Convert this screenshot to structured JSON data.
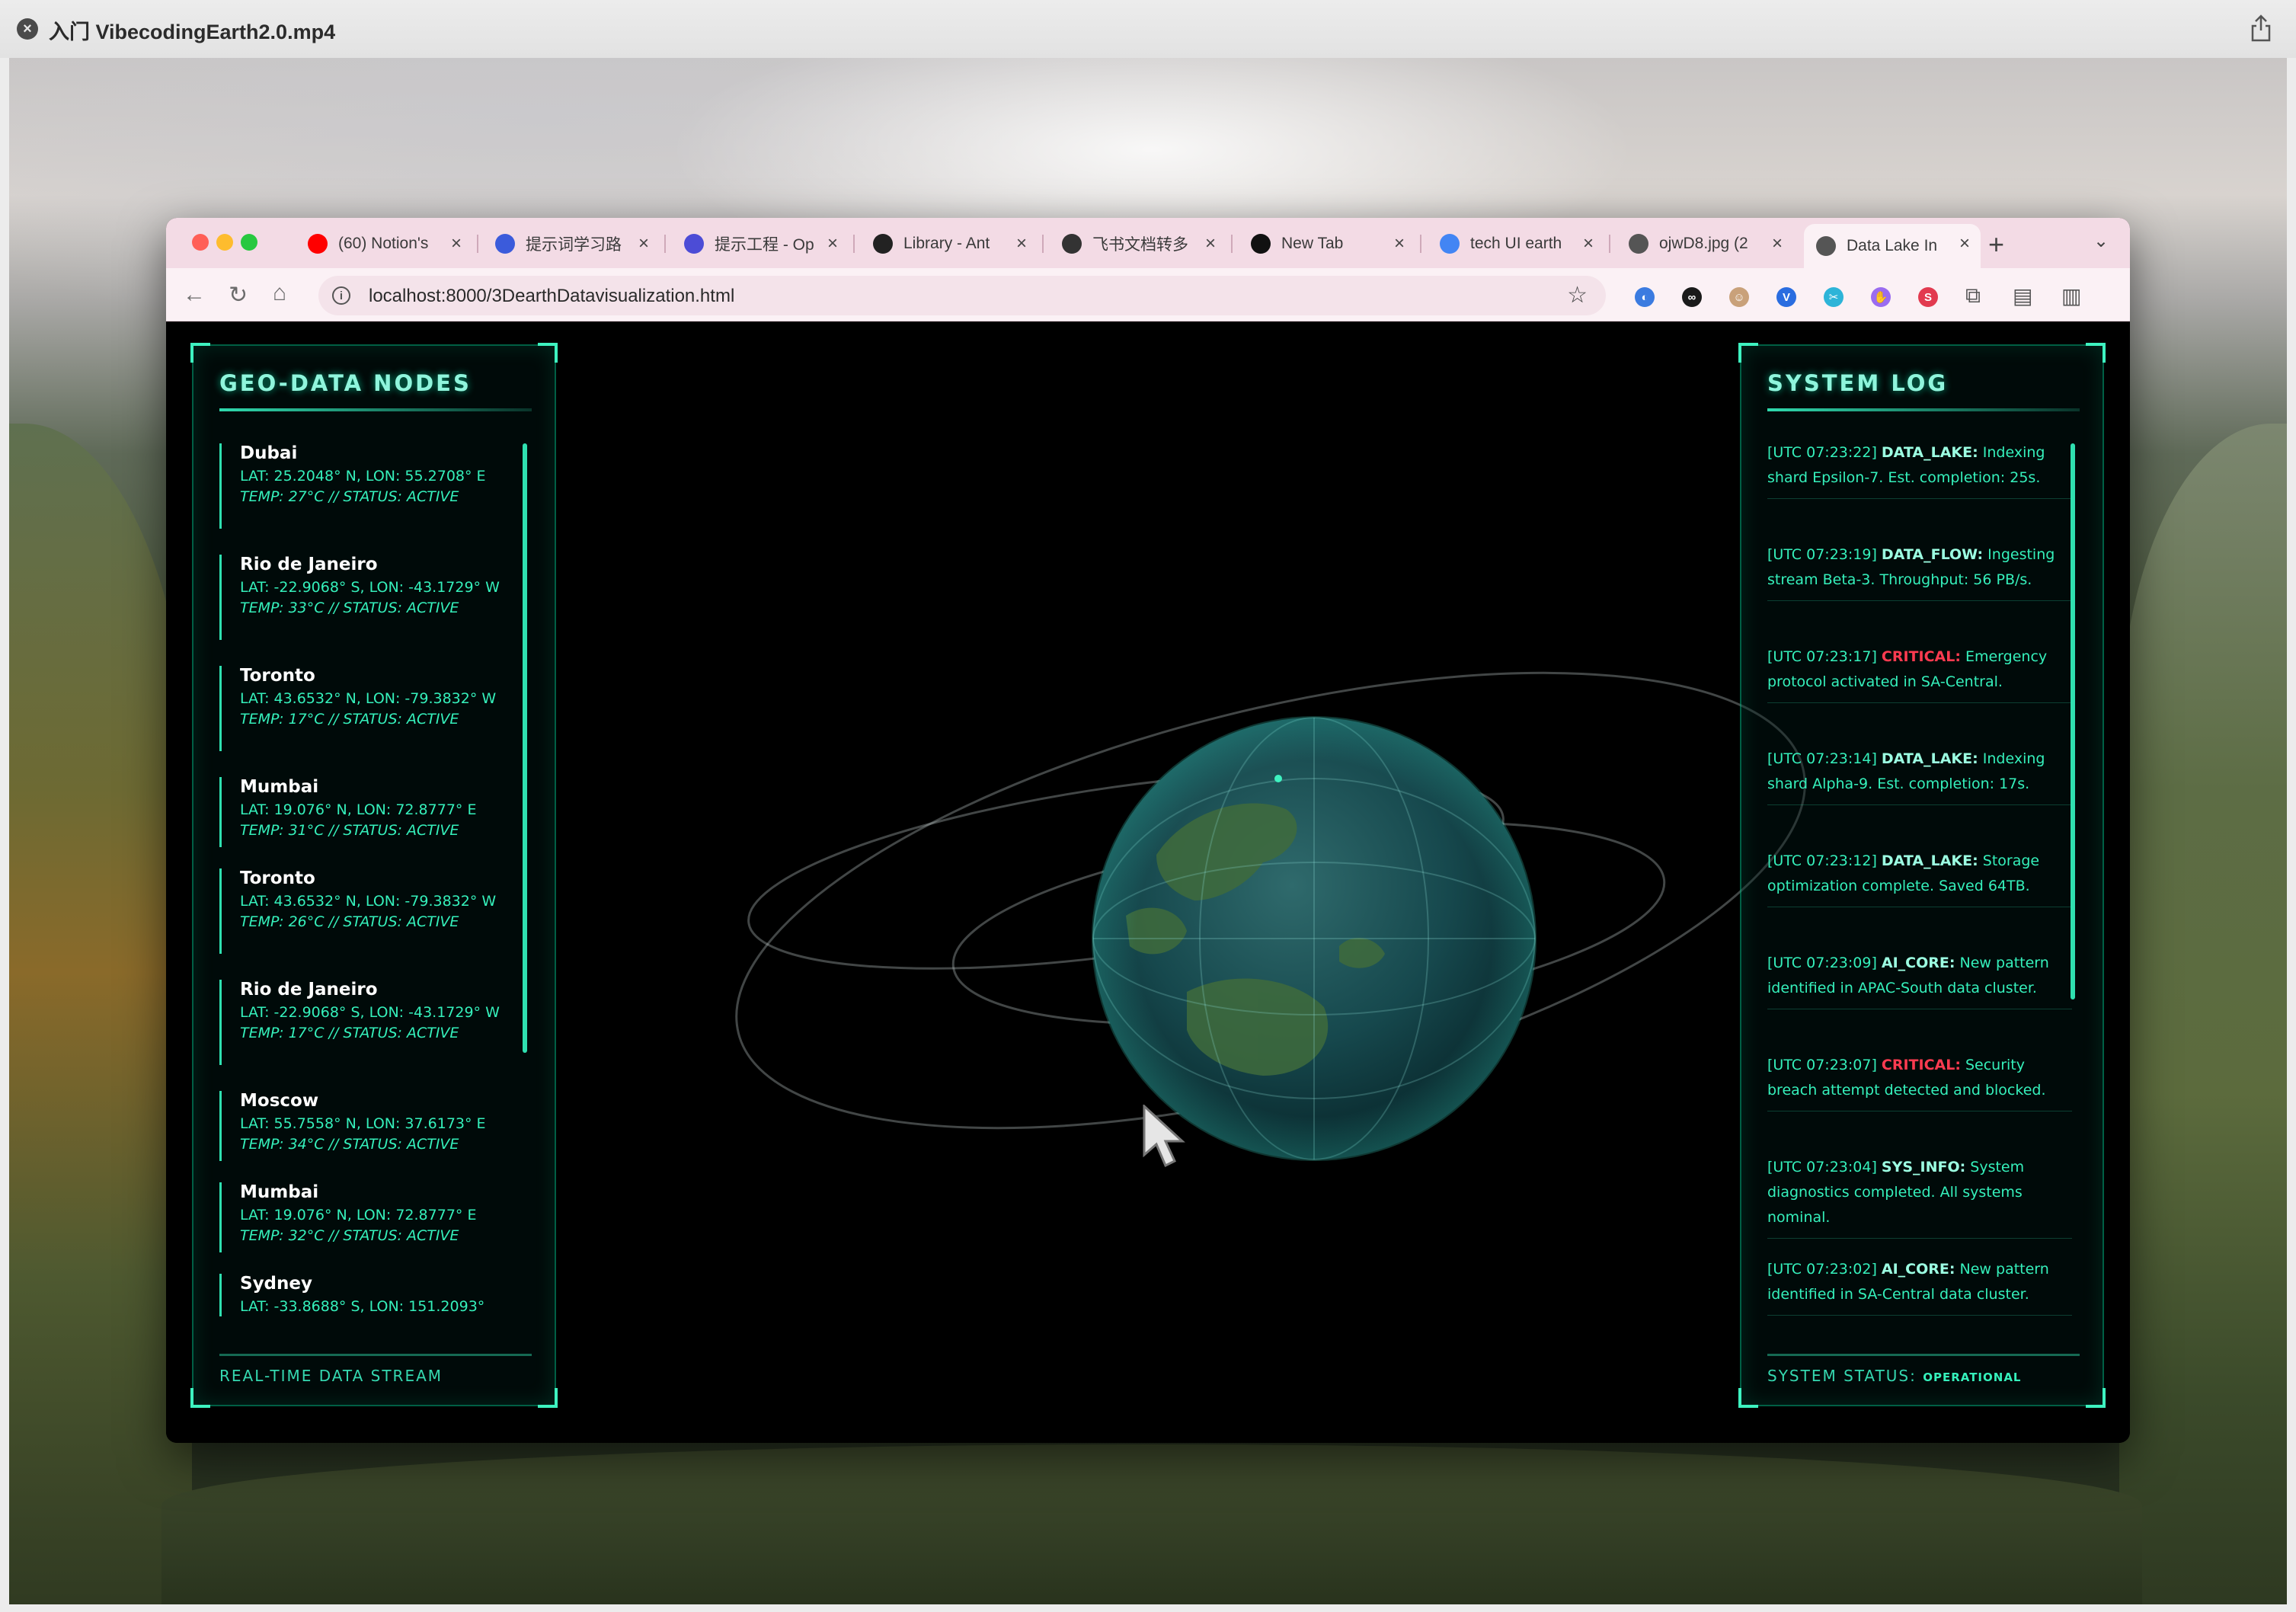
{
  "viewer": {
    "title": "入门 VibecodingEarth2.0.mp4"
  },
  "browser": {
    "tabs": [
      {
        "label": "(60) Notion's",
        "icon": "youtube-icon",
        "color": "#ff0000"
      },
      {
        "label": "提示词学习路",
        "icon": "ai-icon",
        "color": "#3b5bdb"
      },
      {
        "label": "提示工程 - Op",
        "icon": "openai-icon",
        "color": "#4c4cd6"
      },
      {
        "label": "Library - Ant",
        "icon": "anthropic-icon",
        "color": "#222222"
      },
      {
        "label": "飞书文档转多",
        "icon": "lark-icon",
        "color": "#333333"
      },
      {
        "label": "New Tab",
        "icon": "infinity-icon",
        "color": "#111111"
      },
      {
        "label": "tech UI earth",
        "icon": "google-icon",
        "color": "#4285f4"
      },
      {
        "label": "ojwD8.jpg (2",
        "icon": "globe-icon",
        "color": "#555555"
      },
      {
        "label": "Data Lake In",
        "icon": "globe-icon",
        "color": "#555555"
      }
    ],
    "url": "localhost:8000/3DearthDatavisualization.html"
  },
  "left_panel": {
    "title": "GEO-DATA NODES",
    "nodes": [
      {
        "city": "Dubai",
        "coords": "LAT: 25.2048° N, LON: 55.2708° E",
        "meta": "TEMP: 27°C // STATUS: ACTIVE"
      },
      {
        "city": "Rio de Janeiro",
        "coords": "LAT: -22.9068° S, LON: -43.1729° W",
        "meta": "TEMP: 33°C // STATUS: ACTIVE"
      },
      {
        "city": "Toronto",
        "coords": "LAT: 43.6532° N, LON: -79.3832° W",
        "meta": "TEMP: 17°C // STATUS: ACTIVE"
      },
      {
        "city": "Mumbai",
        "coords": "LAT: 19.076° N, LON: 72.8777° E",
        "meta": "TEMP: 31°C // STATUS: ACTIVE"
      },
      {
        "city": "Toronto",
        "coords": "LAT: 43.6532° N, LON: -79.3832° W",
        "meta": "TEMP: 26°C // STATUS: ACTIVE"
      },
      {
        "city": "Rio de Janeiro",
        "coords": "LAT: -22.9068° S, LON: -43.1729° W",
        "meta": "TEMP: 17°C // STATUS: ACTIVE"
      },
      {
        "city": "Moscow",
        "coords": "LAT: 55.7558° N, LON: 37.6173° E",
        "meta": "TEMP: 34°C // STATUS: ACTIVE"
      },
      {
        "city": "Mumbai",
        "coords": "LAT: 19.076° N, LON: 72.8777° E",
        "meta": "TEMP: 32°C // STATUS: ACTIVE"
      },
      {
        "city": "Sydney",
        "coords": "LAT: -33.8688° S, LON: 151.2093°",
        "meta": ""
      }
    ],
    "footer": "REAL-TIME DATA STREAM"
  },
  "right_panel": {
    "title": "SYSTEM LOG",
    "logs": [
      {
        "stamp": "[UTC 07:23:22] ",
        "source": "DATA_LAKE:",
        "critical": false,
        "message": " Indexing shard Epsilon-7. Est. completion: 25s."
      },
      {
        "stamp": "[UTC 07:23:19] ",
        "source": "DATA_FLOW:",
        "critical": false,
        "message": " Ingesting stream Beta-3. Throughput: 56 PB/s."
      },
      {
        "stamp": "[UTC 07:23:17] ",
        "source": "CRITICAL:",
        "critical": true,
        "message": " Emergency protocol activated in SA-Central."
      },
      {
        "stamp": "[UTC 07:23:14] ",
        "source": "DATA_LAKE:",
        "critical": false,
        "message": " Indexing shard Alpha-9. Est. completion: 17s."
      },
      {
        "stamp": "[UTC 07:23:12] ",
        "source": "DATA_LAKE:",
        "critical": false,
        "message": " Storage optimization complete. Saved 64TB."
      },
      {
        "stamp": "[UTC 07:23:09] ",
        "source": "AI_CORE:",
        "critical": false,
        "message": " New pattern identified in APAC-South data cluster."
      },
      {
        "stamp": "[UTC 07:23:07] ",
        "source": "CRITICAL:",
        "critical": true,
        "message": " Security breach attempt detected and blocked."
      },
      {
        "stamp": "[UTC 07:23:04] ",
        "source": "SYS_INFO:",
        "critical": false,
        "message": " System diagnostics completed. All systems nominal."
      },
      {
        "stamp": "[UTC 07:23:02] ",
        "source": "AI_CORE:",
        "critical": false,
        "message": " New pattern identified in SA-Central data cluster."
      }
    ],
    "footer_label": "SYSTEM STATUS: ",
    "footer_value": "OPERATIONAL"
  },
  "colors": {
    "accent": "#35f0bb",
    "critical": "#ff3b50",
    "tabstrip": "#f3dbe5"
  }
}
